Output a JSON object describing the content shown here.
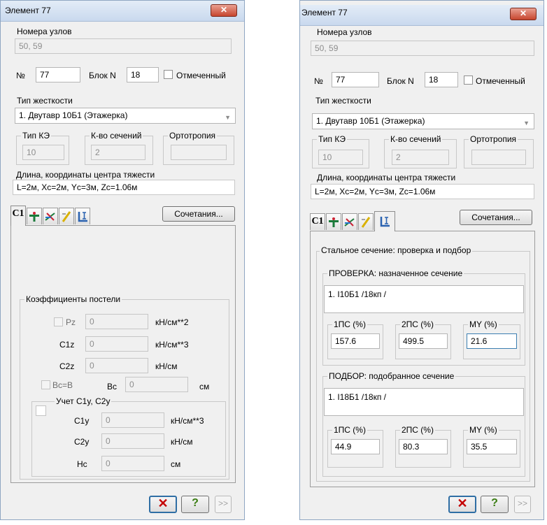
{
  "left": {
    "title": "Элемент 77",
    "close_glyph": "✕",
    "nodes_label": "Номера узлов",
    "nodes_value": "50, 59",
    "number_label": "№",
    "number_value": "77",
    "block_label": "Блок N",
    "block_value": "18",
    "marked_label": "Отмеченный",
    "stiffness_label": "Тип жесткости",
    "stiffness_value": "1. Двутавр 10Б1 (Этажерка)",
    "fe_type_label": "Тип КЭ",
    "fe_type_value": "10",
    "sections_label": "К-во сечений",
    "sections_value": "2",
    "ortho_label": "Ортотропия",
    "ortho_value": "",
    "length_label": "Длина, координаты центра тяжести",
    "length_value": "L=2м, Xc=2м, Yc=3м, Zc=1.06м",
    "tab1_label": "C1",
    "combos_button": "Сочетания...",
    "bed": {
      "title": "Коэффициенты постели",
      "pz_label": "Pz",
      "pz_value": "0",
      "pz_unit": "кН/см**2",
      "c1z_label": "C1z",
      "c1z_value": "0",
      "c1z_unit": "кН/см**3",
      "c2z_label": "C2z",
      "c2z_value": "0",
      "c2z_unit": "кН/см",
      "bc_eq_label": "Bc=B",
      "bc_label": "Bc",
      "bc_value": "0",
      "bc_unit": "см",
      "sub_title": "Учет C1y, C2y",
      "c1y_label": "C1y",
      "c1y_value": "0",
      "c1y_unit": "кН/см**3",
      "c2y_label": "C2y",
      "c2y_value": "0",
      "c2y_unit": "кН/см",
      "hc_label": "Hc",
      "hc_value": "0",
      "hc_unit": "см"
    },
    "btn_cancel": "✕",
    "btn_help": "?",
    "btn_next": ">>"
  },
  "right": {
    "title": "Элемент 77",
    "close_glyph": "✕",
    "nodes_label": "Номера узлов",
    "nodes_value": "50, 59",
    "number_label": "№",
    "number_value": "77",
    "block_label": "Блок N",
    "block_value": "18",
    "marked_label": "Отмеченный",
    "stiffness_label": "Тип жесткости",
    "stiffness_value": "1. Двутавр 10Б1 (Этажерка)",
    "fe_type_label": "Тип КЭ",
    "fe_type_value": "10",
    "sections_label": "К-во сечений",
    "sections_value": "2",
    "ortho_label": "Ортотропия",
    "ortho_value": "",
    "length_label": "Длина, координаты центра тяжести",
    "length_value": "L=2м, Xc=2м, Yc=3м, Zc=1.06м",
    "tab1_label": "C1",
    "combos_button": "Сочетания...",
    "steel": {
      "title": "Стальное сечение: проверка и подбор",
      "check_title": "ПРОВЕРКА: назначенное сечение",
      "check_section": "1. I10Б1   /18кп /",
      "check_cols": [
        "1ПС (%)",
        "2ПС (%)",
        "MY (%)"
      ],
      "check_vals": [
        "157.6",
        "499.5",
        "21.6"
      ],
      "select_title": "ПОДБОР: подобранное сечение",
      "select_section": "1. I18Б1   /18кп /",
      "select_cols": [
        "1ПС (%)",
        "2ПС (%)",
        "MY (%)"
      ],
      "select_vals": [
        "44.9",
        "80.3",
        "35.5"
      ]
    },
    "btn_cancel": "✕",
    "btn_help": "?",
    "btn_next": ">>"
  },
  "icons": [
    "cross-section-icon",
    "supports-icon",
    "ruler-icon",
    "steel-section-icon"
  ],
  "colors": {
    "close_red": "#c7462f",
    "focus_blue": "#3c7fb1",
    "help_green": "#3a7d12"
  }
}
